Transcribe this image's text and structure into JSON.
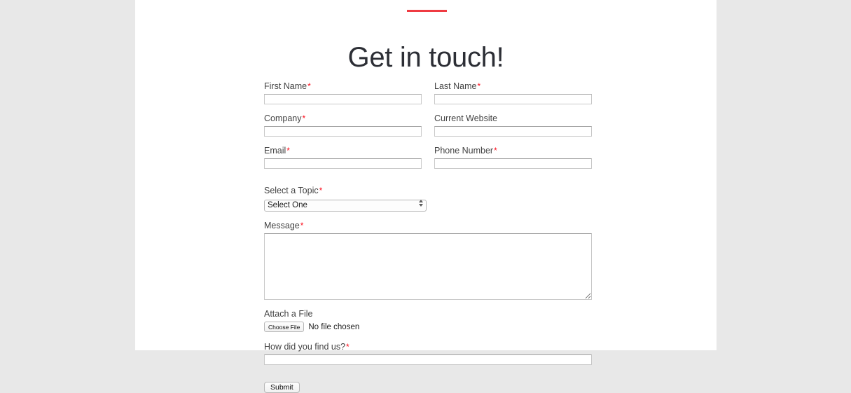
{
  "theme": {
    "accent_red": "#ef3b42",
    "required_mark_color": "#fc0d1b",
    "title_color": "#2c2e35",
    "page_background": "#e8e8e8",
    "content_background": "#ffffff"
  },
  "header": {
    "divider": "divider-rule",
    "title": "Get in touch!"
  },
  "form": {
    "required_mark": "*",
    "fields": {
      "first_name": {
        "label": "First Name",
        "required": true,
        "value": "",
        "placeholder": ""
      },
      "last_name": {
        "label": "Last Name",
        "required": true,
        "value": "",
        "placeholder": ""
      },
      "company": {
        "label": "Company",
        "required": true,
        "value": "",
        "placeholder": ""
      },
      "current_website": {
        "label": "Current Website",
        "required": false,
        "value": "",
        "placeholder": ""
      },
      "email": {
        "label": "Email",
        "required": true,
        "value": "",
        "placeholder": ""
      },
      "phone_number": {
        "label": "Phone Number",
        "required": true,
        "value": "",
        "placeholder": ""
      },
      "topic": {
        "label": "Select a Topic",
        "required": true,
        "selected": "Select One",
        "options": [
          "Select One"
        ]
      },
      "message": {
        "label": "Message",
        "required": true,
        "value": "",
        "placeholder": ""
      },
      "attachment": {
        "label": "Attach a File",
        "required": false,
        "button_label": "Choose File",
        "status": "No file chosen"
      },
      "how_did_you_find_us": {
        "label": "How did you find us?",
        "required": true,
        "value": "",
        "placeholder": ""
      }
    },
    "submit_label": "Submit"
  }
}
